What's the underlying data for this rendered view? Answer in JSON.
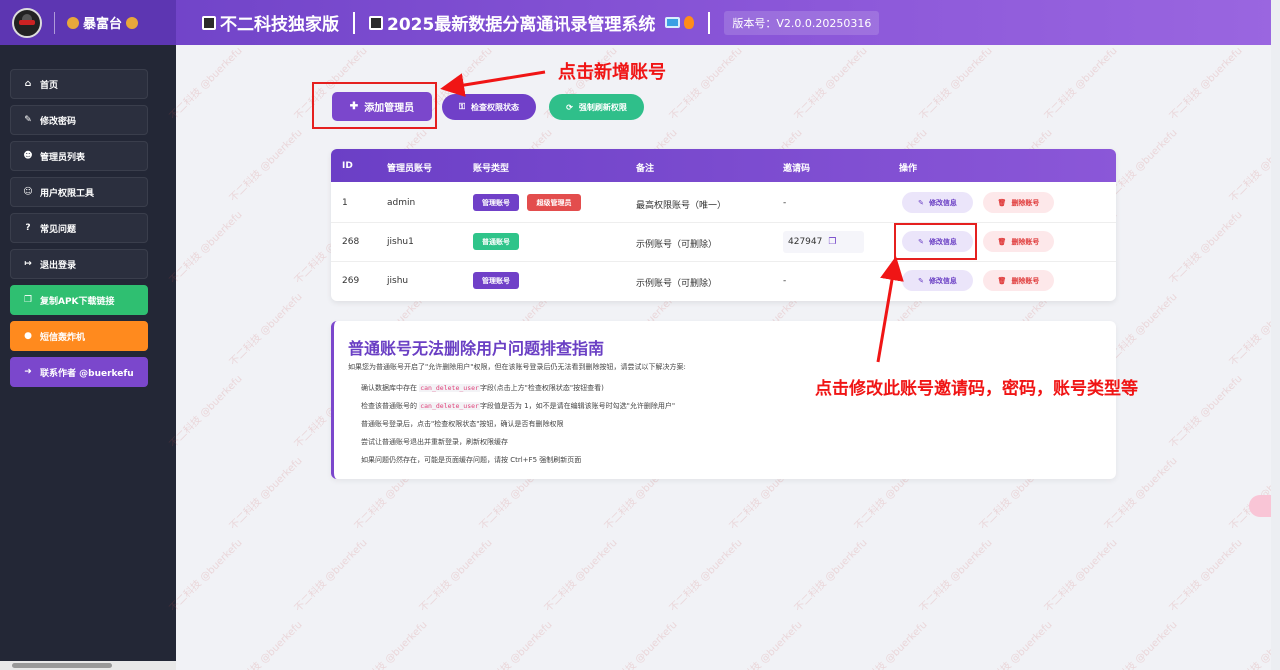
{
  "header": {
    "brand": "暴富台",
    "title_left": "不二科技独家版",
    "title_right": "2025最新数据分离通讯录管理系统",
    "version": "版本号：V2.0.0.20250316"
  },
  "sidebar": {
    "items": [
      {
        "label": "首页",
        "icon": "home-icon"
      },
      {
        "label": "修改密码",
        "icon": "user-edit-icon"
      },
      {
        "label": "管理员列表",
        "icon": "users-icon"
      },
      {
        "label": "用户权限工具",
        "icon": "user-cog-icon"
      },
      {
        "label": "常见问题",
        "icon": "question-icon"
      },
      {
        "label": "退出登录",
        "icon": "logout-icon"
      },
      {
        "label": "复制APK下载链接",
        "icon": "copy-icon"
      },
      {
        "label": "短信轰炸机",
        "icon": "message-icon"
      },
      {
        "label": "联系作者 @buerkefu",
        "icon": "arrow-right-icon"
      }
    ]
  },
  "toolbar": {
    "add_admin": "添加管理员",
    "check_permission": "检查权限状态",
    "force_refresh": "强制刷新权限"
  },
  "annotations": {
    "add_account": "点击新增账号",
    "edit_account": "点击修改此账号邀请码，密码，账号类型等"
  },
  "table": {
    "headers": [
      "ID",
      "管理员账号",
      "账号类型",
      "备注",
      "邀请码",
      "操作"
    ],
    "rows": [
      {
        "id": "1",
        "account": "admin",
        "tags": [
          "管理账号",
          "超级管理员"
        ],
        "note": "最高权限账号（唯一）",
        "invite": "-",
        "edit": "修改信息",
        "delete": "删除账号"
      },
      {
        "id": "268",
        "account": "jishu1",
        "tags": [
          "普通账号"
        ],
        "note": "示例账号（可删除）",
        "invite": "427947",
        "edit": "修改信息",
        "delete": "删除账号"
      },
      {
        "id": "269",
        "account": "jishu",
        "tags": [
          "管理账号"
        ],
        "note": "示例账号（可删除）",
        "invite": "-",
        "edit": "修改信息",
        "delete": "删除账号"
      }
    ]
  },
  "guide": {
    "title": "普通账号无法删除用户问题排查指南",
    "intro": "如果您为普通账号开启了\"允许删除用户\"权限，但在该账号登录后仍无法看到删除按钮，请尝试以下解决方案:",
    "step1_a": "确认数据库中存在",
    "step1_code": "can_delete_user",
    "step1_b": "字段(点击上方\"检查权限状态\"按钮查看)",
    "step2_a": "检查该普通账号的",
    "step2_code": "can_delete_user",
    "step2_b": "字段值是否为 1，如不是请在编辑该账号时勾选\"允许删除用户\"",
    "step3": "普通账号登录后，点击\"检查权限状态\"按钮，确认是否有删除权限",
    "step4": "尝试让普通账号退出并重新登录，刷新权限缓存",
    "step5": "如果问题仍然存在，可能是页面缓存问题，请按 Ctrl+F5 强制刷新页面"
  },
  "watermark": "不二科技 @buerkefu",
  "colors": {
    "primary": "#7b47cc",
    "sidebar_bg": "#232736",
    "green": "#2fbf71",
    "orange": "#ff8a1e",
    "annotation_red": "#f01515"
  }
}
